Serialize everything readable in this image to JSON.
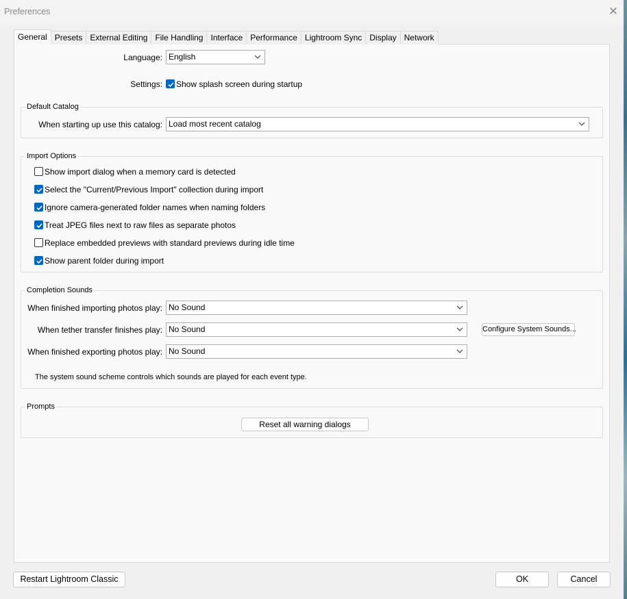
{
  "window": {
    "title": "Preferences"
  },
  "tabs": [
    {
      "label": "General",
      "active": true
    },
    {
      "label": "Presets"
    },
    {
      "label": "External Editing"
    },
    {
      "label": "File Handling"
    },
    {
      "label": "Interface"
    },
    {
      "label": "Performance"
    },
    {
      "label": "Lightroom Sync"
    },
    {
      "label": "Display"
    },
    {
      "label": "Network"
    }
  ],
  "general": {
    "language_label": "Language:",
    "language_value": "English",
    "settings_label": "Settings:",
    "splash_label": "Show splash screen during startup",
    "splash_checked": true
  },
  "default_catalog": {
    "title": "Default Catalog",
    "label": "When starting up use this catalog:",
    "value": "Load most recent catalog"
  },
  "import_options": {
    "title": "Import Options",
    "items": [
      {
        "label": "Show import dialog when a memory card is detected",
        "checked": false
      },
      {
        "label": "Select the \"Current/Previous Import\" collection during import",
        "checked": true
      },
      {
        "label": "Ignore camera-generated folder names when naming folders",
        "checked": true
      },
      {
        "label": "Treat JPEG files next to raw files as separate photos",
        "checked": true
      },
      {
        "label": "Replace embedded previews with standard previews during idle time",
        "checked": false
      },
      {
        "label": "Show parent folder during import",
        "checked": true
      }
    ]
  },
  "completion_sounds": {
    "title": "Completion Sounds",
    "importing_label": "When finished importing photos play:",
    "importing_value": "No Sound",
    "tether_label": "When tether transfer finishes play:",
    "tether_value": "No Sound",
    "exporting_label": "When finished exporting photos play:",
    "exporting_value": "No Sound",
    "configure_button": "Configure System Sounds...",
    "note": "The system sound scheme controls which sounds are played for each event type."
  },
  "prompts": {
    "title": "Prompts",
    "reset_button": "Reset all warning dialogs"
  },
  "footer": {
    "restart_button": "Restart Lightroom Classic",
    "ok_button": "OK",
    "cancel_button": "Cancel"
  },
  "colors": {
    "accent": "#0067c0",
    "background": "#f0f0f0",
    "panel": "#f9f9f9"
  }
}
